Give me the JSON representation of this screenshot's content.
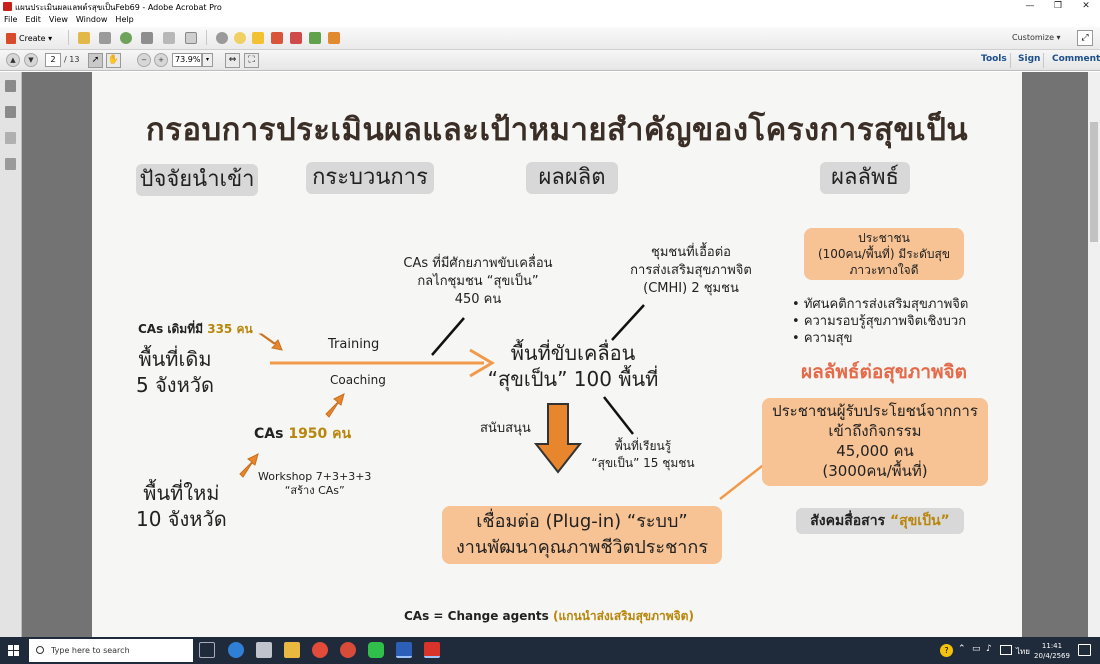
{
  "window": {
    "title": "แผนประเมินผลแลพต์รสุขเป็นFeb69 - Adobe Acrobat Pro"
  },
  "menu": [
    "File",
    "Edit",
    "View",
    "Window",
    "Help"
  ],
  "toolbar": {
    "create_label": "Create",
    "customize_label": "Customize"
  },
  "nav": {
    "page_current": "2",
    "page_total": "/ 13",
    "zoom": "73.9%",
    "tools": "Tools",
    "sign": "Sign",
    "comment": "Comment"
  },
  "slide": {
    "title": "กรอบการประเมินผลและเป้าหมายสำคัญของโครงการสุขเป็น",
    "headers": {
      "inputs": "ปัจจัยนำเข้า",
      "process": "กระบวนการ",
      "outputs": "ผลผลิต",
      "outcomes": "ผลลัพธ์"
    },
    "cas_existing_prefix": "CAs เดิมที่มี ",
    "cas_existing_count": "335 คน",
    "old_area": "พื้นที่เดิม\n5 จังหวัด",
    "new_area": "พื้นที่ใหม่\n10 จังหวัด",
    "training": "Training",
    "coaching": "Coaching",
    "cas_new_prefix": "CAs ",
    "cas_new_count": "1950 คน",
    "workshop": "Workshop 7+3+3+3\n“สร้าง CAs”",
    "cas_potential": "CAs ที่มีศักยภาพขับเคลื่อน\nกลไกชุมชน “สุขเป็น”\n450 คน",
    "cmhi": "ชุมชนที่เอื้อต่อ\nการส่งเสริมสุขภาพจิต\n(CMHI) 2 ชุมชน",
    "driving_areas": "พื้นที่ขับเคลื่อน\n“สุขเป็น” 100 พื้นที่",
    "support": "สนับสนุน",
    "learning": "พื้นที่เรียนรู้\n“สุขเป็น” 15 ชุมชน",
    "plugin": "เชื่อมต่อ (Plug-in) “ระบบ”\nงานพัฒนาคุณภาพชีวิตประชากร",
    "people": "ประชาชน\n(100คน/พื้นที่) มีระดับสุข\nภาวะทางใจดี",
    "bullets": [
      "ทัศนคติการส่งเสริมสุขภาพจิต",
      "ความรอบรู้สุขภาพจิตเชิงบวก",
      "ความสุข"
    ],
    "mh_outcome": "ผลลัพธ์ต่อสุขภาพจิต",
    "beneficiaries": "ประชาชนผู้รับประโยชน์จากการ\nเข้าถึงกิจกรรม\n45,000 คน\n(3000คน/พื้นที่)",
    "comm_prefix": "สังคมสื่อสาร ",
    "comm_name": "“สุขเป็น”",
    "footnote_prefix": "CAs = Change agents ",
    "footnote_suffix": "(แกนนำส่งเสริมสุขภาพจิต)"
  },
  "taskbar": {
    "search_placeholder": "Type here to search",
    "lang": "ไทย",
    "time": "11:41",
    "date": "20/4/2569"
  },
  "colors": {
    "orange_box": "#f7c394",
    "arrow": "#f29a4a",
    "arrow_dark": "#e8862e",
    "header_box": "#d8d8d8",
    "title_text": "#3a2e26",
    "outcome_red": "#e56a4a",
    "gold_text": "#b8860b"
  }
}
